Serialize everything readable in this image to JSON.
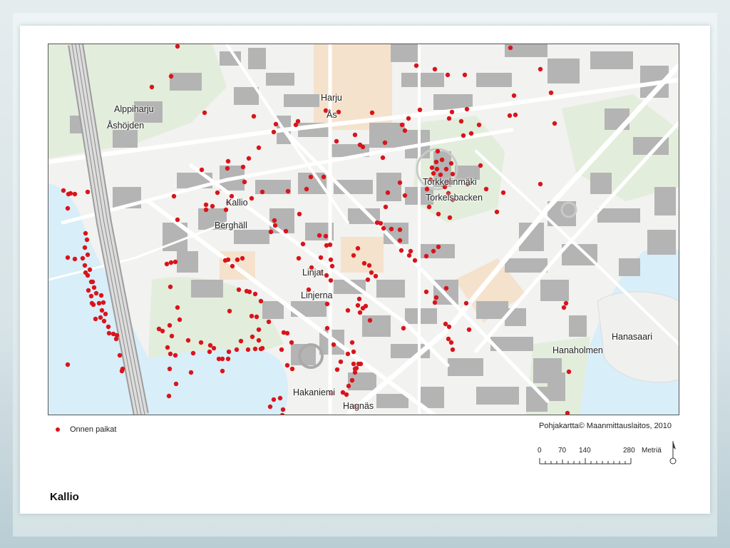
{
  "slide": {
    "title": "Kallio"
  },
  "map": {
    "place_labels": [
      {
        "id": "alppiharju",
        "text": "Alppiharju"
      },
      {
        "id": "asojden",
        "text": "Åshöjden"
      },
      {
        "id": "harju",
        "text": "Harju"
      },
      {
        "id": "as",
        "text": "Ås"
      },
      {
        "id": "torkkelinmaki",
        "text": "Torkkelinmäki"
      },
      {
        "id": "torkelsbacken",
        "text": "Torkelsbacken"
      },
      {
        "id": "kallio",
        "text": "Kallio"
      },
      {
        "id": "berghall",
        "text": "Berghäll"
      },
      {
        "id": "linjat",
        "text": "Linjat"
      },
      {
        "id": "linjerna",
        "text": "Linjerna"
      },
      {
        "id": "hanasaari",
        "text": "Hanasaari"
      },
      {
        "id": "hanaholmen",
        "text": "Hanaholmen"
      },
      {
        "id": "hakaniemi",
        "text": "Hakaniemi"
      },
      {
        "id": "hagnas",
        "text": "Hagnäs"
      }
    ],
    "colors": {
      "water": "#d8eef8",
      "park": "#e3eddc",
      "sand": "#f5e2cd",
      "building": "#b4b4b4",
      "road": "#ffffff",
      "marker": "#d9141b"
    }
  },
  "legend": {
    "marker_label": "Onnen paikat"
  },
  "credit": "Pohjakartta© Maanmittauslaitos,  2010",
  "scale": {
    "ticks": [
      "0",
      "70",
      "140",
      "280"
    ],
    "unit": "Metriä"
  },
  "north_arrow_icon": "north-arrow-icon"
}
